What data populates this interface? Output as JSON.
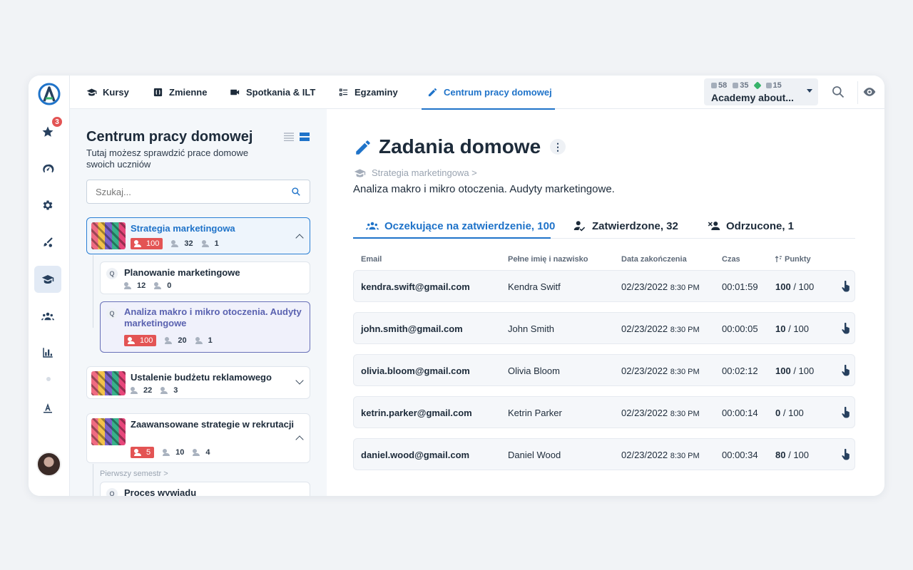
{
  "nav": {
    "tabs": [
      {
        "label": "Kursy",
        "icon": "graduation-cap-icon"
      },
      {
        "label": "Zmienne",
        "icon": "variables-icon"
      },
      {
        "label": "Spotkania & ILT",
        "icon": "video-camera-icon"
      },
      {
        "label": "Egzaminy",
        "icon": "checklist-icon"
      },
      {
        "label": "Centrum pracy domowej",
        "icon": "pencil-icon",
        "active": true
      }
    ],
    "account": {
      "stats": [
        "58",
        "35",
        "15"
      ],
      "name": "Academy about..."
    },
    "favorites_badge": "3"
  },
  "sidebar": {
    "title": "Centrum pracy domowej",
    "subtitle": "Tutaj możesz sprawdzić prace domowe swoich uczniów",
    "search_placeholder": "Szukaj...",
    "courses": [
      {
        "title": "Strategia marketingowa",
        "pending": "100",
        "approved": "32",
        "rejected": "1",
        "expanded": true,
        "tasks": [
          {
            "title": "Planowanie marketingowe",
            "approved": "12",
            "rejected": "0"
          },
          {
            "title": "Analiza makro i mikro otoczenia. Audyty marketingowe",
            "pending": "100",
            "approved": "20",
            "rejected": "1",
            "selected": true
          }
        ]
      },
      {
        "title": "Ustalenie budżetu reklamowego",
        "approved": "22",
        "rejected": "3",
        "expanded": false
      },
      {
        "title": "Zaawansowane strategie w rekrutacji",
        "pending": "5",
        "approved": "10",
        "rejected": "4",
        "expanded": true,
        "crumb": "Pierwszy semestr >",
        "tasks": [
          {
            "title": "Proces wywiadu"
          }
        ]
      }
    ]
  },
  "main": {
    "title": "Zadania domowe",
    "breadcrumb": "Strategia marketingowa >",
    "description": "Analiza makro i mikro otoczenia. Audyty marketingowe.",
    "tabs": [
      {
        "label": "Oczekujące na zatwierdzenie, 100"
      },
      {
        "label": "Zatwierdzone, 32"
      },
      {
        "label": "Odrzucone, 1"
      }
    ],
    "columns": {
      "email": "Email",
      "name": "Pełne imię i nazwisko",
      "date": "Data zakończenia",
      "time": "Czas",
      "points": "Punkty"
    },
    "rows": [
      {
        "email": "kendra.swift@gmail.com",
        "name": "Kendra Switf",
        "date": "02/23/2022",
        "hour": "8:30 PM",
        "time": "00:01:59",
        "score": "100",
        "max": "/ 100"
      },
      {
        "email": "john.smith@gmail.com",
        "name": "John Smith",
        "date": "02/23/2022",
        "hour": "8:30 PM",
        "time": "00:00:05",
        "score": "10",
        "max": "/ 100"
      },
      {
        "email": "olivia.bloom@gmail.com",
        "name": "Olivia Bloom",
        "date": "02/23/2022",
        "hour": "8:30 PM",
        "time": "00:02:12",
        "score": "100",
        "max": "/ 100"
      },
      {
        "email": "ketrin.parker@gmail.com",
        "name": "Ketrin Parker",
        "date": "02/23/2022",
        "hour": "8:30 PM",
        "time": "00:00:14",
        "score": "0",
        "max": "/ 100"
      },
      {
        "email": "daniel.wood@gmail.com",
        "name": "Daniel Wood",
        "date": "02/23/2022",
        "hour": "8:30 PM",
        "time": "00:00:34",
        "score": "80",
        "max": "/ 100"
      }
    ]
  },
  "colors": {
    "accent": "#1f73c9",
    "danger": "#e35454",
    "selected_task": "#5a62b0"
  }
}
